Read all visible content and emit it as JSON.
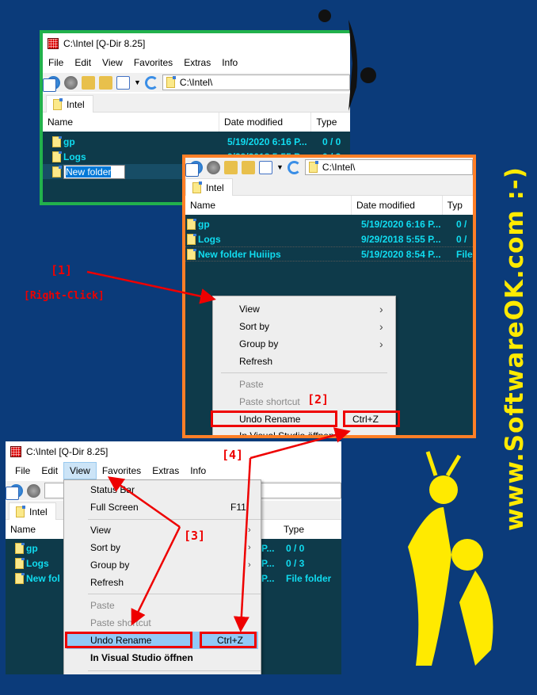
{
  "colors": {
    "background": "#0b3b7a",
    "window1_border": "#22b14c",
    "window2_border": "#ff7f27",
    "annotation": "#ee0000",
    "watermark": "#ffea00",
    "list_bg": "#0e3a4a",
    "list_text": "#10dcf0"
  },
  "watermark": "www.SoftwareOK.com :-)",
  "window1": {
    "title": "C:\\Intel  [Q-Dir 8.25]",
    "menu": [
      "File",
      "Edit",
      "View",
      "Favorites",
      "Extras",
      "Info"
    ],
    "address": "C:\\Intel\\",
    "tab": "Intel",
    "columns": [
      "Name",
      "Date modified",
      "Type"
    ],
    "rows": [
      {
        "name": "gp",
        "date": "5/19/2020 6:16 P...",
        "type": "0 / 0"
      },
      {
        "name": "Logs",
        "date": "9/29/2018 5:55 P...",
        "type": "0 / 3"
      }
    ],
    "rename_value": "New folder"
  },
  "window2": {
    "address": "C:\\Intel\\",
    "tab": "Intel",
    "columns": [
      "Name",
      "Date modified",
      "Typ"
    ],
    "rows": [
      {
        "name": "gp",
        "date": "5/19/2020 6:16 P...",
        "type": "0 /"
      },
      {
        "name": "Logs",
        "date": "9/29/2018 5:55 P...",
        "type": "0 /"
      },
      {
        "name": "New folder Huiiips",
        "date": "5/19/2020 8:54 P...",
        "type": "File"
      }
    ],
    "context_menu": {
      "items": [
        {
          "label": "View"
        },
        {
          "label": "Sort by"
        },
        {
          "label": "Group by"
        },
        {
          "label": "Refresh"
        },
        {
          "label": "Paste"
        },
        {
          "label": "Paste shortcut"
        },
        {
          "label": "Undo Rename",
          "shortcut": "Ctrl+Z"
        },
        {
          "label": "In Visual Studio öffnen"
        }
      ]
    }
  },
  "window3": {
    "title": "C:\\Intel  [Q-Dir 8.25]",
    "menu": [
      "File",
      "Edit",
      "View",
      "Favorites",
      "Extras",
      "Info"
    ],
    "tab": "Intel",
    "columns": [
      "Name",
      "Type"
    ],
    "rows": [
      {
        "name": "gp",
        "date": "P...",
        "type": "0 / 0"
      },
      {
        "name": "Logs",
        "date": "P...",
        "type": "0 / 3"
      },
      {
        "name": "New fol",
        "date": "P...",
        "type": "File folder"
      }
    ],
    "view_menu": {
      "items": [
        {
          "label": "Status Bar"
        },
        {
          "label": "Full Screen",
          "shortcut": "F11"
        },
        {
          "label": "View"
        },
        {
          "label": "Sort by"
        },
        {
          "label": "Group by"
        },
        {
          "label": "Refresh"
        },
        {
          "label": "Paste"
        },
        {
          "label": "Paste shortcut"
        },
        {
          "label": "Undo Rename",
          "shortcut": "Ctrl+Z"
        },
        {
          "label": "In Visual Studio öffnen"
        }
      ]
    }
  },
  "annotations": {
    "step1": "[1]",
    "right_click": "[Right-Click]",
    "step2": "[2]",
    "step3": "[3]",
    "step4": "[4]"
  }
}
